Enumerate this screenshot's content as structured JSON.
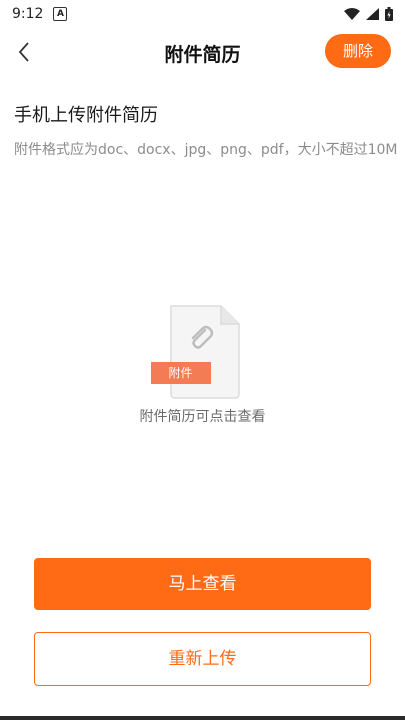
{
  "status_bar": {
    "time": "9:12",
    "notification_icon": "A"
  },
  "header": {
    "title": "附件简历",
    "delete_label": "删除",
    "back_icon": "chevron-left-icon"
  },
  "section": {
    "title": "手机上传附件简历",
    "description": "附件格式应为doc、docx、jpg、png、pdf，大小不超过10M"
  },
  "file_preview": {
    "tag_label": "附件",
    "hint": "附件简历可点击查看",
    "icon": "paperclip-icon"
  },
  "actions": {
    "view_label": "马上查看",
    "reupload_label": "重新上传"
  },
  "colors": {
    "accent": "#ff6a14",
    "tag": "#f47c55"
  }
}
